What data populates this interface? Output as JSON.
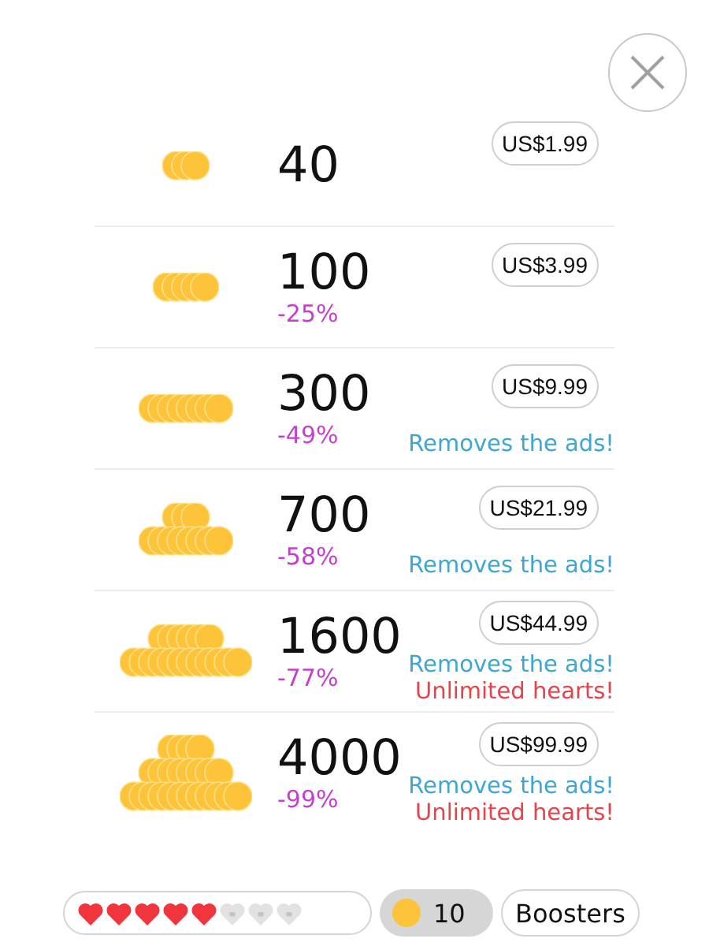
{
  "packages": [
    {
      "amount": "40",
      "price": "US$1.99"
    },
    {
      "amount": "100",
      "discount": "-25%",
      "price": "US$3.99"
    },
    {
      "amount": "300",
      "discount": "-49%",
      "price": "US$9.99",
      "perks": [
        {
          "kind": "ads",
          "text": "Removes the ads!"
        }
      ]
    },
    {
      "amount": "700",
      "discount": "-58%",
      "price": "US$21.99",
      "perks": [
        {
          "kind": "ads",
          "text": "Removes the ads!"
        }
      ]
    },
    {
      "amount": "1600",
      "discount": "-77%",
      "price": "US$44.99",
      "perks": [
        {
          "kind": "ads",
          "text": "Removes the ads!"
        },
        {
          "kind": "hearts",
          "text": "Unlimited hearts!"
        }
      ]
    },
    {
      "amount": "4000",
      "discount": "-99%",
      "price": "US$99.99",
      "perks": [
        {
          "kind": "ads",
          "text": "Removes the ads!"
        },
        {
          "kind": "hearts",
          "text": "Unlimited hearts!"
        }
      ]
    }
  ],
  "hearts": [
    {
      "filled": true
    },
    {
      "filled": true
    },
    {
      "filled": true
    },
    {
      "filled": true
    },
    {
      "filled": true
    },
    {
      "filled": false
    },
    {
      "filled": false
    },
    {
      "filled": false
    }
  ],
  "coins": "10",
  "boosters_button": "Boosters"
}
